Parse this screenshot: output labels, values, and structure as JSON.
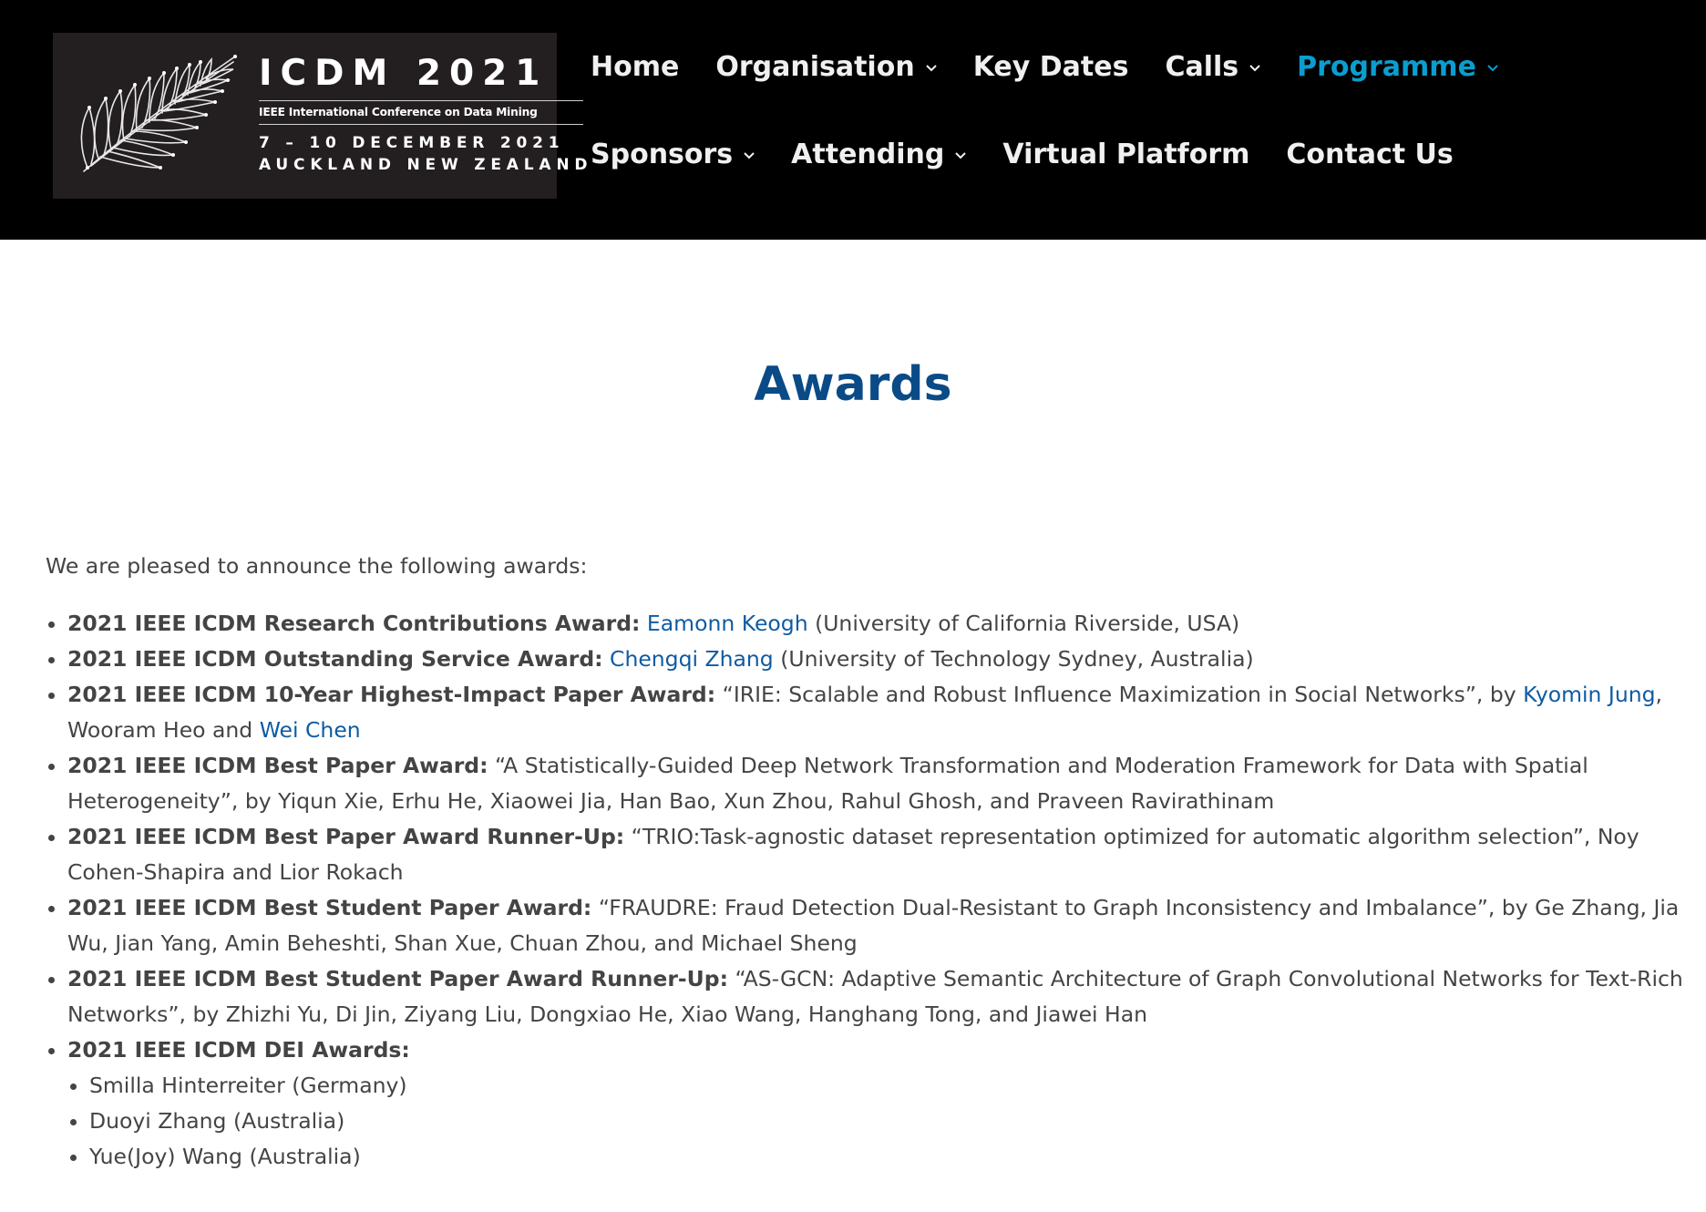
{
  "header": {
    "logo": {
      "title": "ICDM 2021",
      "subtitle": "IEEE International Conference on Data Mining",
      "dates": "7 – 10 DECEMBER 2021",
      "place": "AUCKLAND NEW ZEALAND"
    },
    "nav_row1": [
      {
        "label": "Home",
        "has_dropdown": false,
        "active": false
      },
      {
        "label": "Organisation",
        "has_dropdown": true,
        "active": false
      },
      {
        "label": "Key Dates",
        "has_dropdown": false,
        "active": false
      },
      {
        "label": "Calls",
        "has_dropdown": true,
        "active": false
      },
      {
        "label": "Programme",
        "has_dropdown": true,
        "active": true
      }
    ],
    "nav_row2": [
      {
        "label": "Sponsors",
        "has_dropdown": true,
        "active": false
      },
      {
        "label": "Attending",
        "has_dropdown": true,
        "active": false
      },
      {
        "label": "Virtual Platform",
        "has_dropdown": false,
        "active": false
      },
      {
        "label": "Contact Us",
        "has_dropdown": false,
        "active": false
      }
    ]
  },
  "colors": {
    "header_bg": "#000000",
    "nav_text": "#f0f0f0",
    "nav_active": "#0a9ed0",
    "title": "#0a4a87",
    "link": "#0e5ba3",
    "body_text": "#444444"
  },
  "page": {
    "title": "Awards",
    "intro": "We are pleased to announce the following awards:",
    "awards": [
      {
        "label": "2021 IEEE ICDM Research Contributions Award:",
        "parts": [
          {
            "type": "link",
            "text": "Eamonn Keogh"
          },
          {
            "type": "text",
            "text": " (University of California Riverside, USA)"
          }
        ]
      },
      {
        "label": "2021 IEEE ICDM Outstanding Service Award:",
        "parts": [
          {
            "type": "link",
            "text": "Chengqi Zhang"
          },
          {
            "type": "text",
            "text": " (University of Technology Sydney, Australia)"
          }
        ]
      },
      {
        "label": "2021 IEEE ICDM 10-Year Highest-Impact Paper Award:",
        "parts": [
          {
            "type": "text",
            "text": "“IRIE: Scalable and Robust Influence Maximization in Social Networks”, by "
          },
          {
            "type": "link",
            "text": "Kyomin Jung"
          },
          {
            "type": "text",
            "text": ", Wooram Heo and "
          },
          {
            "type": "link",
            "text": "Wei Chen"
          }
        ]
      },
      {
        "label": "2021 IEEE ICDM Best Paper Award:",
        "parts": [
          {
            "type": "text",
            "text": "“A Statistically-Guided Deep Network Transformation and Moderation Framework for Data with Spatial Heterogeneity”, by Yiqun Xie, Erhu He, Xiaowei Jia, Han Bao, Xun Zhou, Rahul Ghosh, and Praveen Ravirathinam"
          }
        ]
      },
      {
        "label": "2021 IEEE ICDM Best Paper Award Runner-Up:",
        "parts": [
          {
            "type": "text",
            "text": "“TRIO:Task-agnostic dataset representation optimized for automatic algorithm selection”, Noy Cohen-Shapira and Lior Rokach"
          }
        ]
      },
      {
        "label": "2021 IEEE ICDM Best Student Paper Award:",
        "parts": [
          {
            "type": "text",
            "text": "“FRAUDRE: Fraud Detection Dual-Resistant to Graph Inconsistency and Imbalance”, by Ge Zhang, Jia Wu, Jian Yang, Amin Beheshti, Shan Xue, Chuan Zhou, and Michael Sheng"
          }
        ]
      },
      {
        "label": "2021 IEEE ICDM Best Student Paper Award Runner-Up:",
        "parts": [
          {
            "type": "text",
            "text": "“AS-GCN: Adaptive Semantic Architecture of Graph Convolutional Networks for Text-Rich Networks”, by Zhizhi Yu, Di Jin, Ziyang Liu, Dongxiao He, Xiao Wang, Hanghang Tong, and Jiawei Han"
          }
        ]
      },
      {
        "label": "2021 IEEE ICDM DEI Awards:",
        "parts": [],
        "recipients": [
          "Smilla Hinterreiter (Germany)",
          "Duoyi Zhang (Australia)",
          "Yue(Joy) Wang (Australia)"
        ]
      }
    ]
  }
}
